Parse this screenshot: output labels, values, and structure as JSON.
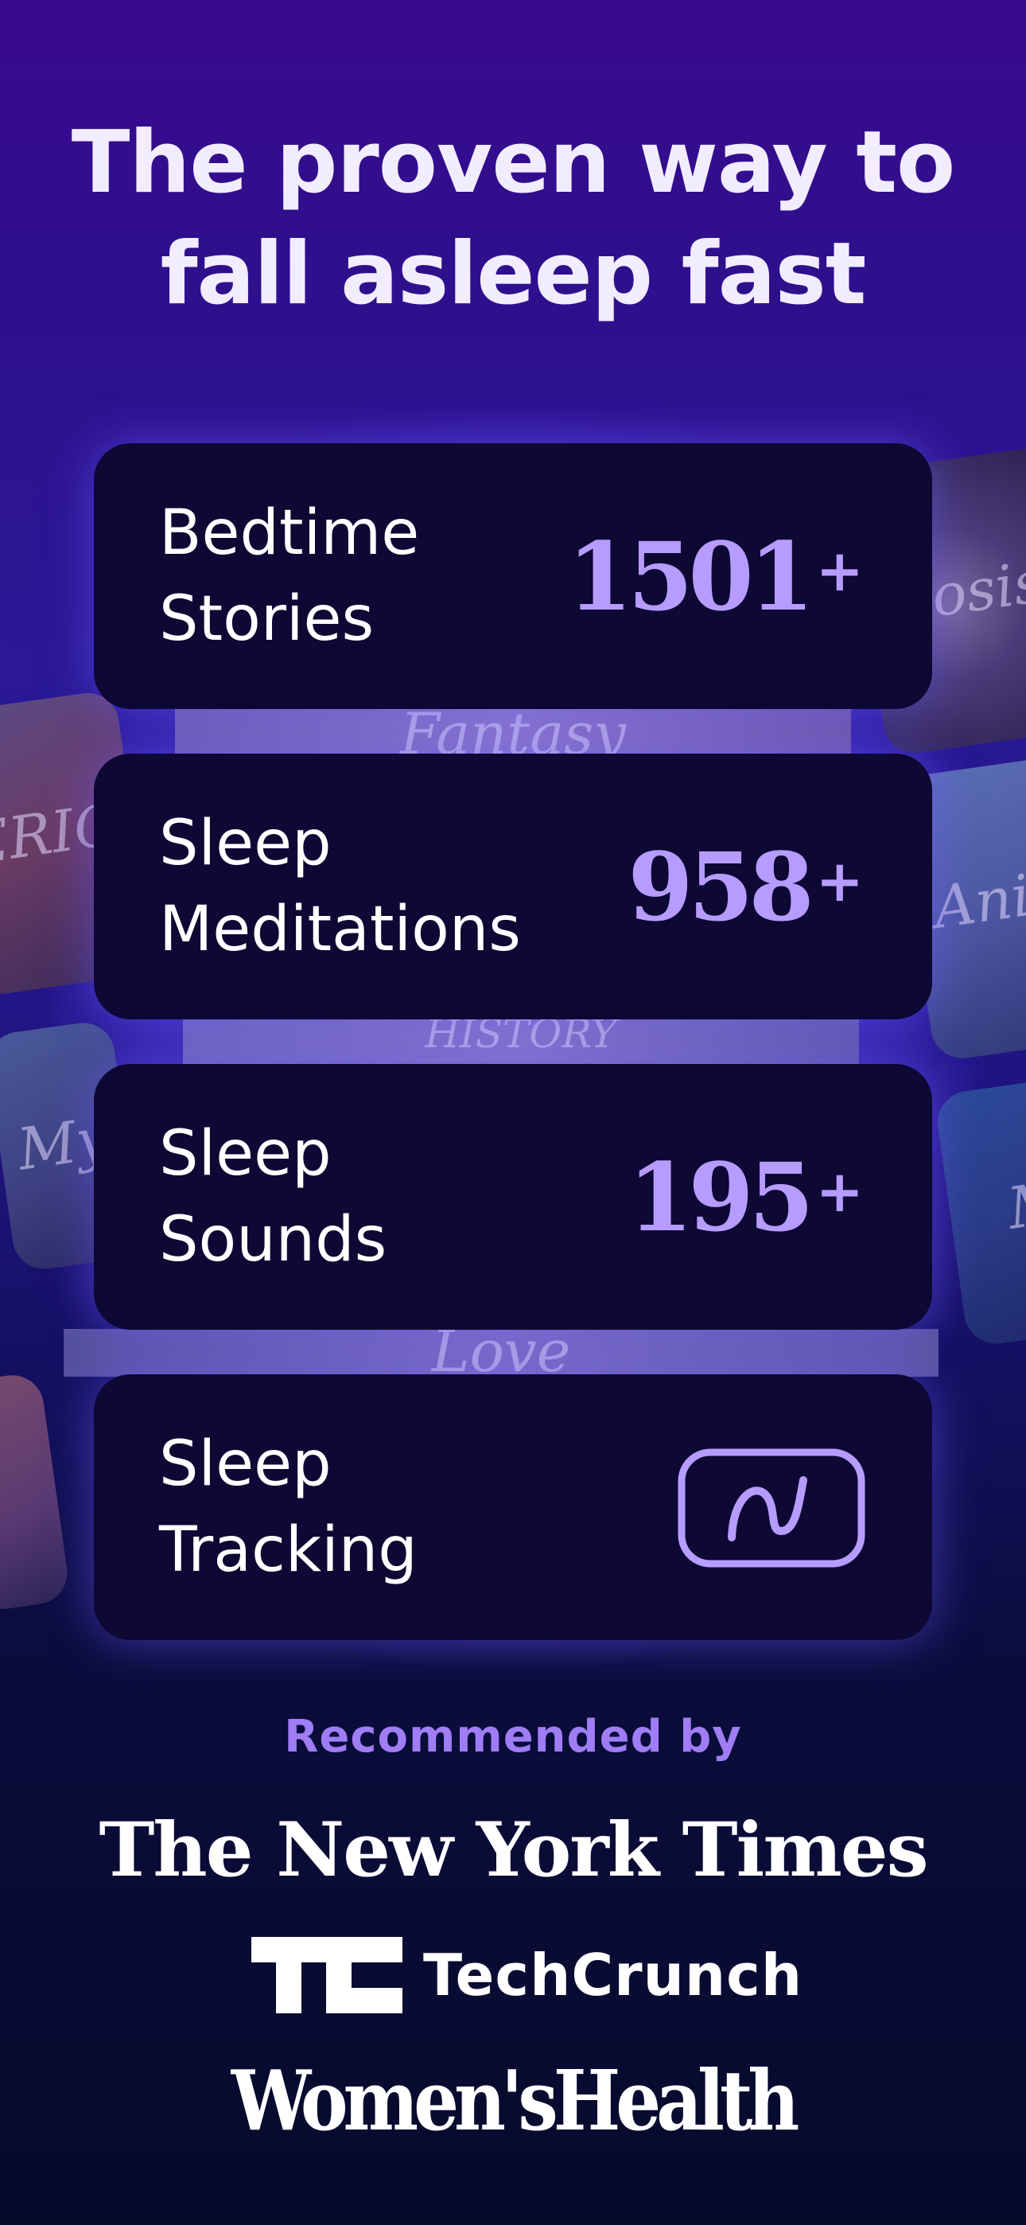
{
  "headline": {
    "line1": "The proven way to",
    "line2": "fall asleep fast"
  },
  "background_art": [
    {
      "text": "nosis"
    },
    {
      "text": "ERIC"
    },
    {
      "text": "Fantasy"
    },
    {
      "text": "Anim"
    },
    {
      "text": "HISTORY"
    },
    {
      "text": "My"
    },
    {
      "text": "M"
    },
    {
      "text": "Love"
    }
  ],
  "features": [
    {
      "title_line1": "Bedtime",
      "title_line2": "Stories",
      "count": "1501",
      "suffix": "+"
    },
    {
      "title_line1": "Sleep",
      "title_line2": "Meditations",
      "count": "958",
      "suffix": "+"
    },
    {
      "title_line1": "Sleep",
      "title_line2": "Sounds",
      "count": "195",
      "suffix": "+"
    },
    {
      "title_line1": "Sleep",
      "title_line2": "Tracking",
      "icon": "sleep-wave-icon"
    }
  ],
  "recommended": {
    "label": "Recommended by",
    "logos": [
      "The New York Times",
      "TechCrunch",
      "Women'sHealth"
    ]
  },
  "colors": {
    "accent": "#b79cff",
    "card_bg": "#0d0834",
    "recommended_text": "#9f7df5",
    "bg_top": "#3a0a8e",
    "bg_bottom": "#070a2b"
  }
}
